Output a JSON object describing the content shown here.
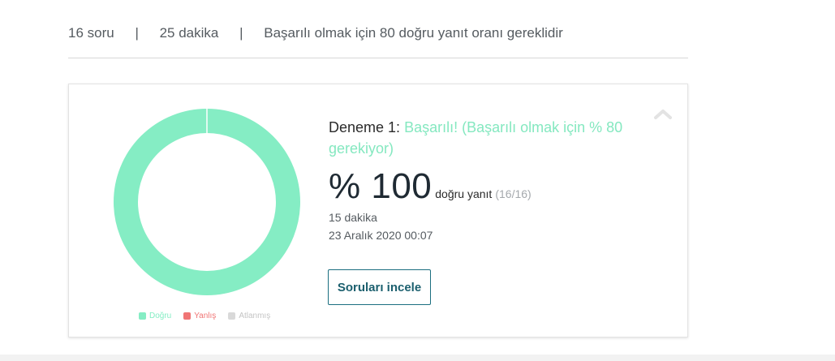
{
  "summary": {
    "questions": "16 soru",
    "duration": "25 dakika",
    "separator": "|",
    "pass_requirement": "Başarılı olmak için 80 doğru yanıt oranı gereklidir"
  },
  "attempt": {
    "label": "Deneme 1: ",
    "status": "Başarılı! (Başarılı olmak için % 80 gerekiyor)",
    "score_percent": "% 100",
    "score_label": "doğru yanıt",
    "score_count": "(16/16)",
    "time_spent": "15 dakika",
    "date": "23 Aralık 2020 00:07",
    "review_button": "Soruları incele"
  },
  "chart_data": {
    "type": "pie",
    "categories": [
      "Doğru",
      "Yanlış",
      "Atlanmış"
    ],
    "values": [
      16,
      0,
      0
    ],
    "colors": [
      "#85edc4",
      "#f07575",
      "#d9d9d9"
    ],
    "legend_position": "bottom"
  },
  "icons": {
    "collapse": "chevron-up-icon"
  }
}
